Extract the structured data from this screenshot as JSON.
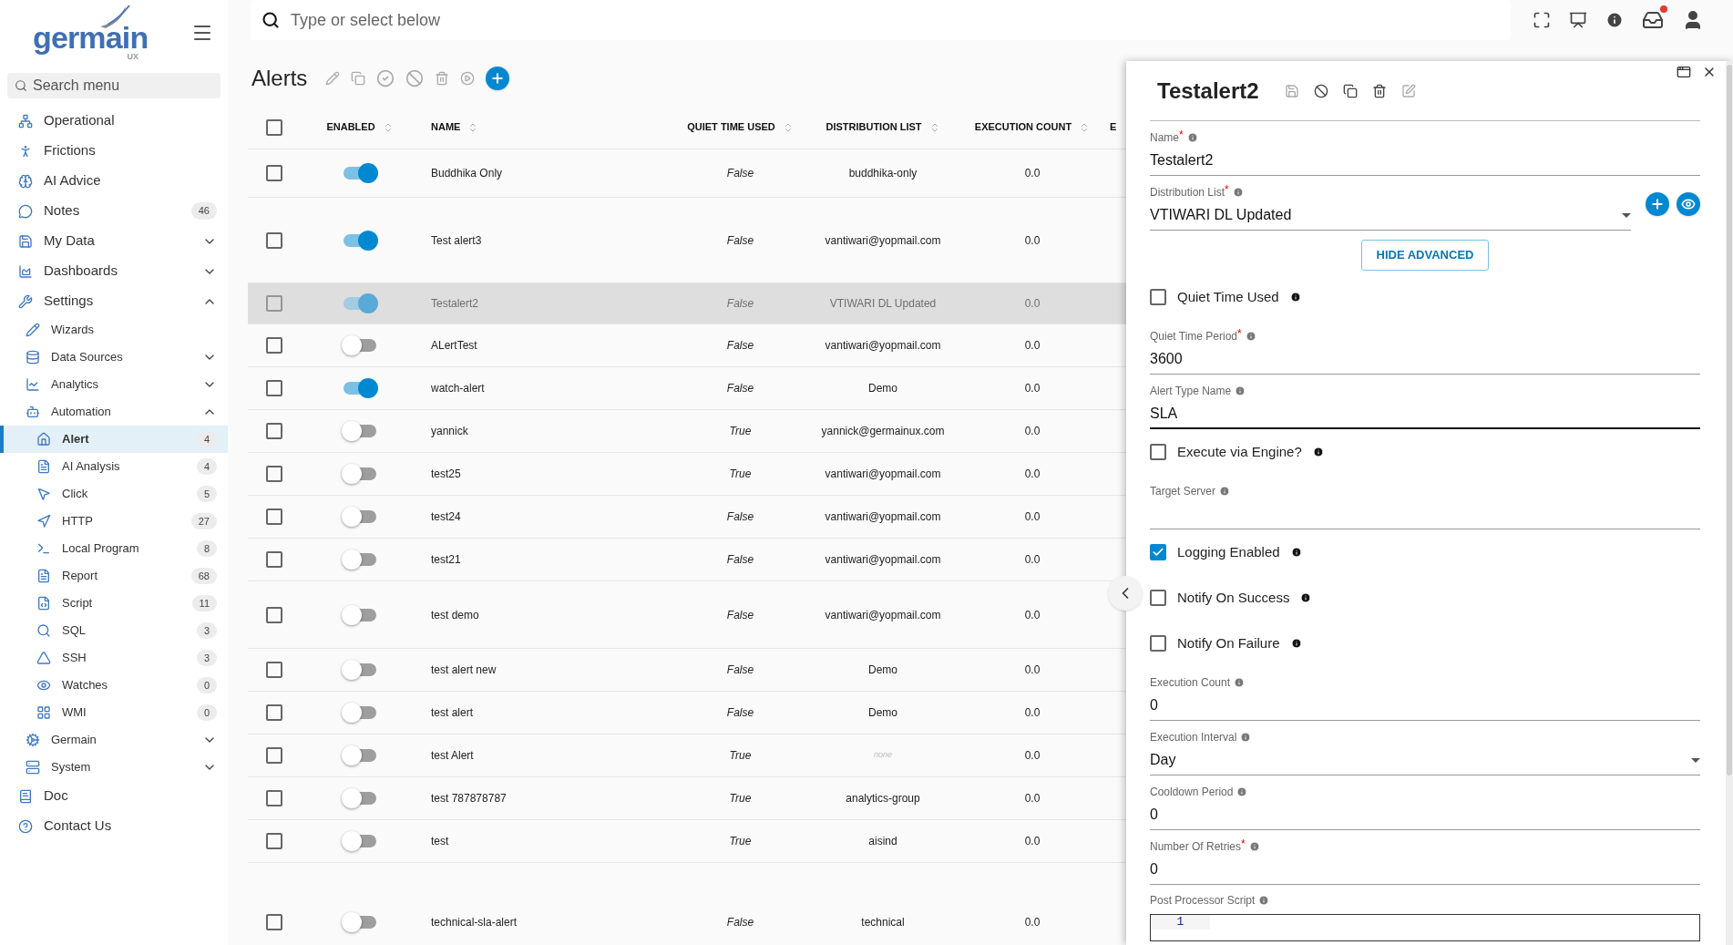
{
  "logo": {
    "word": "germain",
    "suffix": "UX"
  },
  "sidebar": {
    "search": {
      "placeholder": "Search menu"
    },
    "items": [
      {
        "label": "Operational",
        "selected": false
      },
      {
        "label": "Frictions",
        "selected": false
      },
      {
        "label": "AI Advice",
        "selected": false
      },
      {
        "label": "Notes",
        "count": "46",
        "selected": false
      },
      {
        "label": "My Data",
        "expanded": false,
        "selected": false
      },
      {
        "label": "Dashboards",
        "expanded": false,
        "selected": false
      },
      {
        "label": "Settings",
        "expanded": true,
        "selected": false,
        "children": [
          {
            "label": "Wizards",
            "selected": false
          },
          {
            "label": "Data Sources",
            "expanded": false,
            "selected": false
          },
          {
            "label": "Analytics",
            "expanded": false,
            "selected": false
          },
          {
            "label": "Automation",
            "expanded": true,
            "selected": false,
            "children": [
              {
                "label": "Alert",
                "count": "4",
                "selected": true
              },
              {
                "label": "AI Analysis",
                "count": "4",
                "selected": false
              },
              {
                "label": "Click",
                "count": "5",
                "selected": false
              },
              {
                "label": "HTTP",
                "count": "27",
                "selected": false
              },
              {
                "label": "Local Program",
                "count": "8",
                "selected": false
              },
              {
                "label": "Report",
                "count": "68",
                "selected": false
              },
              {
                "label": "Script",
                "count": "11",
                "selected": false
              },
              {
                "label": "SQL",
                "count": "3",
                "selected": false
              },
              {
                "label": "SSH",
                "count": "3",
                "selected": false
              },
              {
                "label": "Watches",
                "count": "0",
                "selected": false
              },
              {
                "label": "WMI",
                "count": "0",
                "selected": false
              }
            ]
          },
          {
            "label": "Germain",
            "expanded": false,
            "selected": false
          },
          {
            "label": "System",
            "expanded": false,
            "selected": false
          }
        ]
      },
      {
        "label": "Doc",
        "selected": false
      },
      {
        "label": "Contact Us",
        "selected": false
      }
    ]
  },
  "top_bar": {
    "search": {
      "placeholder": "Type or select below"
    },
    "notification_dot": true
  },
  "page": {
    "title": "Alerts"
  },
  "table": {
    "select_all_checked": false,
    "columns": [
      {
        "label": "ENABLED"
      },
      {
        "label": "NAME"
      },
      {
        "label": "QUIET TIME USED"
      },
      {
        "label": "DISTRIBUTION LIST"
      },
      {
        "label": "EXECUTION COUNT"
      },
      {
        "label": "E"
      }
    ],
    "rows": [
      {
        "checked": false,
        "enabled": true,
        "name": "Buddhika Only",
        "quiet_time_used": "False",
        "distribution_list": "buddhika-only",
        "distribution_empty": false,
        "execution_count": "0.0",
        "selected": false
      },
      {
        "checked": false,
        "enabled": true,
        "name": "Test alert3",
        "quiet_time_used": "False",
        "distribution_list": "vantiwari@yopmail.com",
        "distribution_empty": false,
        "execution_count": "0.0",
        "selected": false
      },
      {
        "checked": false,
        "enabled": true,
        "name": "Testalert2",
        "quiet_time_used": "False",
        "distribution_list": "VTIWARI DL Updated",
        "distribution_empty": false,
        "execution_count": "0.0",
        "selected": true
      },
      {
        "checked": false,
        "enabled": false,
        "name": "ALertTest",
        "quiet_time_used": "False",
        "distribution_list": "vantiwari@yopmail.com",
        "distribution_empty": false,
        "execution_count": "0.0",
        "selected": false
      },
      {
        "checked": false,
        "enabled": true,
        "name": "watch-alert",
        "quiet_time_used": "False",
        "distribution_list": "Demo",
        "distribution_empty": false,
        "execution_count": "0.0",
        "selected": false
      },
      {
        "checked": false,
        "enabled": false,
        "name": "yannick",
        "quiet_time_used": "True",
        "distribution_list": "yannick@germainux.com",
        "distribution_empty": false,
        "execution_count": "0.0",
        "selected": false
      },
      {
        "checked": false,
        "enabled": false,
        "name": "test25",
        "quiet_time_used": "True",
        "distribution_list": "vantiwari@yopmail.com",
        "distribution_empty": false,
        "execution_count": "0.0",
        "selected": false
      },
      {
        "checked": false,
        "enabled": false,
        "name": "test24",
        "quiet_time_used": "False",
        "distribution_list": "vantiwari@yopmail.com",
        "distribution_empty": false,
        "execution_count": "0.0",
        "selected": false
      },
      {
        "checked": false,
        "enabled": false,
        "name": "test21",
        "quiet_time_used": "False",
        "distribution_list": "vantiwari@yopmail.com",
        "distribution_empty": false,
        "execution_count": "0.0",
        "selected": false
      },
      {
        "checked": false,
        "enabled": false,
        "name": "test demo",
        "quiet_time_used": "False",
        "distribution_list": "vantiwari@yopmail.com",
        "distribution_empty": false,
        "execution_count": "0.0",
        "selected": false
      },
      {
        "checked": false,
        "enabled": false,
        "name": "test alert new",
        "quiet_time_used": "False",
        "distribution_list": "Demo",
        "distribution_empty": false,
        "execution_count": "0.0",
        "selected": false
      },
      {
        "checked": false,
        "enabled": false,
        "name": "test alert",
        "quiet_time_used": "False",
        "distribution_list": "Demo",
        "distribution_empty": false,
        "execution_count": "0.0",
        "selected": false
      },
      {
        "checked": false,
        "enabled": false,
        "name": "test Alert",
        "quiet_time_used": "True",
        "distribution_list": "none",
        "distribution_empty": true,
        "execution_count": "0.0",
        "selected": false
      },
      {
        "checked": false,
        "enabled": false,
        "name": "test 787878787",
        "quiet_time_used": "True",
        "distribution_list": "analytics-group",
        "distribution_empty": false,
        "execution_count": "0.0",
        "selected": false
      },
      {
        "checked": false,
        "enabled": false,
        "name": "test",
        "quiet_time_used": "True",
        "distribution_list": "aisind",
        "distribution_empty": false,
        "execution_count": "0.0",
        "selected": false
      },
      {
        "checked": false,
        "enabled": false,
        "name": "technical-sla-alert",
        "quiet_time_used": "False",
        "distribution_list": "technical",
        "distribution_empty": false,
        "execution_count": "0.0",
        "selected": false
      }
    ]
  },
  "detail_panel": {
    "title": "Testalert2",
    "fields": [
      {
        "kind": "text",
        "label": "Name",
        "required_mark": "*",
        "value": "Testalert2",
        "focused": false
      },
      {
        "kind": "select",
        "label": "Distribution List",
        "required_mark": "*",
        "value": "VTIWARI DL Updated",
        "actions": true
      },
      {
        "kind": "button",
        "label": "HIDE ADVANCED"
      },
      {
        "kind": "checkbox",
        "label": "Quiet Time Used",
        "checked": false
      },
      {
        "kind": "text",
        "label": "Quiet Time Period",
        "required_mark": "*",
        "value": "3600",
        "focused": false
      },
      {
        "kind": "text",
        "label": "Alert Type Name",
        "value": "SLA",
        "focused": true
      },
      {
        "kind": "checkbox",
        "label": "Execute via Engine?",
        "checked": false
      },
      {
        "kind": "text",
        "label": "Target Server",
        "focused": false
      },
      {
        "kind": "checkbox",
        "label": "Logging Enabled",
        "checked": true
      },
      {
        "kind": "checkbox",
        "label": "Notify On Success",
        "checked": false
      },
      {
        "kind": "checkbox",
        "label": "Notify On Failure",
        "checked": false
      },
      {
        "kind": "text",
        "label": "Execution Count",
        "value": "0",
        "focused": false
      },
      {
        "kind": "select",
        "label": "Execution Interval",
        "value": "Day",
        "actions": false
      },
      {
        "kind": "text",
        "label": "Cooldown Period",
        "value": "0",
        "focused": false
      },
      {
        "kind": "text",
        "label": "Number Of Retries",
        "required_mark": "*",
        "value": "0",
        "focused": false
      },
      {
        "kind": "code",
        "label": "Post Processor Script",
        "line_number": "1"
      }
    ]
  }
}
